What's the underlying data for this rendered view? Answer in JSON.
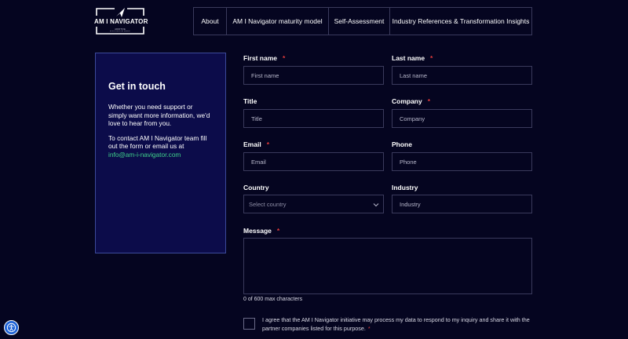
{
  "header": {
    "logo_title": "AM I NAVIGATOR",
    "logo_tagline": "ADDITIVE MANUFACTURING NAVIGATOR",
    "nav": [
      {
        "label": "About"
      },
      {
        "label": "AM I Navigator maturity model"
      },
      {
        "label": "Self-Assessment"
      },
      {
        "label": "Industry References & Transformation Insights"
      }
    ]
  },
  "contact": {
    "title": "Get in touch",
    "intro": "Whether you need support or simply want more information, we'd love to hear from you.",
    "instruction": "To contact AM I Navigator team fill out the form or email us at",
    "email": "info@am-i-navigator.com"
  },
  "form": {
    "required_marker": "*",
    "first_name": {
      "label": "First name",
      "placeholder": "First name"
    },
    "last_name": {
      "label": "Last name",
      "placeholder": "Last name"
    },
    "title": {
      "label": "Title",
      "placeholder": "Title"
    },
    "company": {
      "label": "Company",
      "placeholder": "Company"
    },
    "email": {
      "label": "Email",
      "placeholder": "Email"
    },
    "phone": {
      "label": "Phone",
      "placeholder": "Phone"
    },
    "country": {
      "label": "Country",
      "value": "Select country"
    },
    "industry": {
      "label": "Industry",
      "placeholder": "Industry"
    },
    "message": {
      "label": "Message",
      "counter": "0 of 600 max characters"
    },
    "consent": {
      "text": "I agree that the AM I Navigator initiative may process my data to respond to my inquiry and share it with the partner companies listed for this purpose."
    }
  },
  "colors": {
    "background": "#050520",
    "card": "#0c0c4a",
    "accent_email": "#3fd28a",
    "required": "#e23b3b",
    "a11y": "#1f63d6"
  },
  "icons": {
    "logo": "navigator-arrow-icon",
    "select": "chevron-down-icon",
    "accessibility": "accessibility-icon"
  }
}
